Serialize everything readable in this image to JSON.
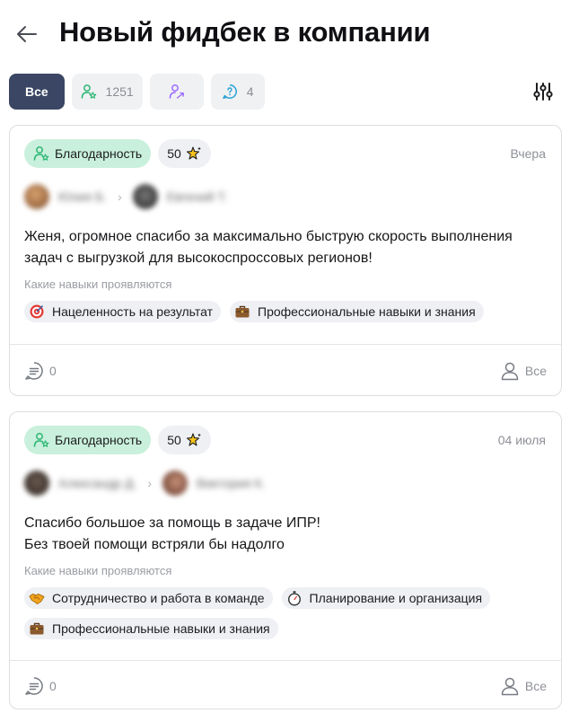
{
  "header": {
    "title": "Новый фидбек в компании"
  },
  "filters": {
    "all_label": "Все",
    "thanks_count": "1251",
    "questions_count": "4"
  },
  "feedback": [
    {
      "type_label": "Благодарность",
      "points": "50",
      "date": "Вчера",
      "from_name": "Юлия Б.",
      "to_name": "Евгений Т.",
      "message_lines": [
        "Женя, огромное спасибо за максимально быструю скорость выполнения",
        "задач с выгрузкой для высокоспроссовых регионов!"
      ],
      "skills_label": "Какие навыки проявляются",
      "skills": [
        {
          "icon": "target-icon",
          "label": "Нацеленность на результат"
        },
        {
          "icon": "briefcase-icon",
          "label": "Профессиональные навыки и знания"
        }
      ],
      "comments_count": "0",
      "visibility_label": "Все"
    },
    {
      "type_label": "Благодарность",
      "points": "50",
      "date": "04 июля",
      "from_name": "Александр Д.",
      "to_name": "Виктория К.",
      "message_lines": [
        "Спасибо большое за помощь в задаче ИПР!",
        "Без твоей помощи встряли бы надолго"
      ],
      "skills_label": "Какие навыки проявляются",
      "skills": [
        {
          "icon": "handshake-icon",
          "label": "Сотрудничество и работа в команде"
        },
        {
          "icon": "stopwatch-icon",
          "label": "Планирование и организация"
        },
        {
          "icon": "briefcase-icon",
          "label": "Профессиональные навыки и знания"
        }
      ],
      "comments_count": "0",
      "visibility_label": "Все"
    }
  ],
  "colors": {
    "accent_dark": "#3a4663",
    "thanks_bg": "#c9f0dc",
    "thanks_icon": "#2bb673",
    "request_icon": "#9b6bff",
    "question_icon": "#2aa3d6"
  }
}
